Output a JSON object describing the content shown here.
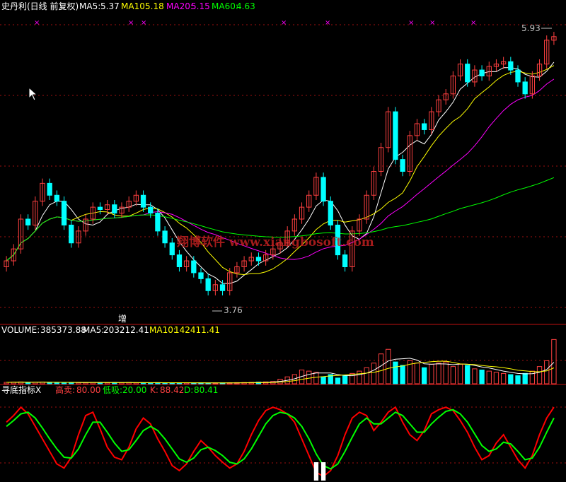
{
  "main_panel": {
    "stock_name": "史丹利(日线 前复权)",
    "ma5_label": "MA5:",
    "ma5_value": "5.37",
    "ma10_label": "MA10:",
    "ma10_value": "5.18",
    "ma20_label": "MA20:",
    "ma20_value": "5.15",
    "ma60_label": "MA60:",
    "ma60_value": "4.63",
    "high_marker": "5.93",
    "low_marker": "3.76",
    "watermark": "翔博软件 www.xiangbosoft.com",
    "signal_label": "增"
  },
  "volume_panel": {
    "label": "VOLUME:",
    "value": "385373.88",
    "ma5_label": "MA5:",
    "ma5_value": "203212.41",
    "ma10_label": "MA10:",
    "ma10_value": "142411.41"
  },
  "indicator_panel": {
    "name": "寻底指标X",
    "sell_label": "高卖:",
    "sell_value": "80.00",
    "buy_label": "低吸:",
    "buy_value": "20.00",
    "k_label": "K:",
    "k_value": "88.42",
    "d_label": "D:",
    "d_value": "80.41"
  },
  "colors": {
    "up": "#ff4040",
    "down": "#00ffff",
    "ma5": "#ffffff",
    "ma10": "#ffff00",
    "ma20": "#ff00ff",
    "ma60": "#00ff00",
    "k_line": "#ff0000",
    "d_line": "#00ff00",
    "grid": "#a01010"
  },
  "chart_data": {
    "type": "candlestick",
    "price_ylim": [
      3.6,
      6.0
    ],
    "closes": [
      4.05,
      4.15,
      4.4,
      4.35,
      4.55,
      4.7,
      4.6,
      4.55,
      4.35,
      4.2,
      4.3,
      4.4,
      4.5,
      4.48,
      4.52,
      4.45,
      4.5,
      4.55,
      4.6,
      4.5,
      4.45,
      4.3,
      4.2,
      4.1,
      4.0,
      4.05,
      3.95,
      3.9,
      3.8,
      3.85,
      3.8,
      3.95,
      4.0,
      4.05,
      4.08,
      4.05,
      4.1,
      4.15,
      4.2,
      4.3,
      4.4,
      4.5,
      4.6,
      4.75,
      4.55,
      4.35,
      4.1,
      4.0,
      4.3,
      4.4,
      4.6,
      4.8,
      5.0,
      5.3,
      4.9,
      4.8,
      5.1,
      5.2,
      5.15,
      5.3,
      5.4,
      5.45,
      5.6,
      5.7,
      5.55,
      5.65,
      5.6,
      5.68,
      5.7,
      5.72,
      5.65,
      5.55,
      5.45,
      5.6,
      5.7,
      5.9,
      5.93
    ],
    "volume_ylim": [
      0,
      400000
    ],
    "volumes": [
      12000,
      14000,
      16000,
      11000,
      13000,
      15000,
      12000,
      10000,
      11000,
      9000,
      10000,
      11000,
      12000,
      10000,
      9000,
      11000,
      10000,
      12000,
      9000,
      8000,
      9000,
      10000,
      8000,
      7000,
      8000,
      9000,
      7000,
      8000,
      6000,
      7000,
      8000,
      9000,
      10000,
      11000,
      12000,
      14000,
      16000,
      20000,
      40000,
      60000,
      80000,
      120000,
      110000,
      100000,
      60000,
      80000,
      50000,
      70000,
      90000,
      110000,
      140000,
      180000,
      260000,
      300000,
      190000,
      160000,
      200000,
      180000,
      140000,
      170000,
      180000,
      190000,
      150000,
      170000,
      160000,
      130000,
      120000,
      110000,
      100000,
      90000,
      80000,
      70000,
      90000,
      110000,
      150000,
      200000,
      385373.88
    ],
    "indicator_ylim": [
      0,
      100
    ],
    "k": [
      70,
      78,
      88,
      80,
      65,
      50,
      35,
      20,
      15,
      28,
      55,
      78,
      82,
      62,
      40,
      28,
      25,
      40,
      62,
      75,
      68,
      50,
      35,
      18,
      12,
      20,
      35,
      48,
      40,
      30,
      22,
      15,
      20,
      35,
      55,
      72,
      84,
      88,
      85,
      80,
      70,
      50,
      30,
      10,
      5,
      12,
      30,
      55,
      75,
      82,
      78,
      60,
      70,
      82,
      88,
      70,
      55,
      48,
      60,
      80,
      85,
      88,
      84,
      72,
      58,
      40,
      25,
      30,
      45,
      55,
      40,
      25,
      15,
      30,
      55,
      75,
      88
    ],
    "d": [
      65,
      72,
      80,
      82,
      75,
      63,
      50,
      38,
      28,
      27,
      38,
      55,
      70,
      70,
      58,
      45,
      35,
      37,
      48,
      60,
      65,
      60,
      50,
      38,
      26,
      22,
      27,
      37,
      40,
      36,
      30,
      22,
      20,
      26,
      38,
      53,
      68,
      78,
      82,
      80,
      75,
      65,
      50,
      32,
      18,
      14,
      20,
      35,
      52,
      68,
      75,
      68,
      68,
      75,
      82,
      78,
      68,
      58,
      58,
      68,
      76,
      83,
      85,
      80,
      70,
      56,
      42,
      35,
      38,
      46,
      44,
      35,
      25,
      27,
      40,
      58,
      75
    ],
    "sell_level": 80,
    "buy_level": 20
  }
}
